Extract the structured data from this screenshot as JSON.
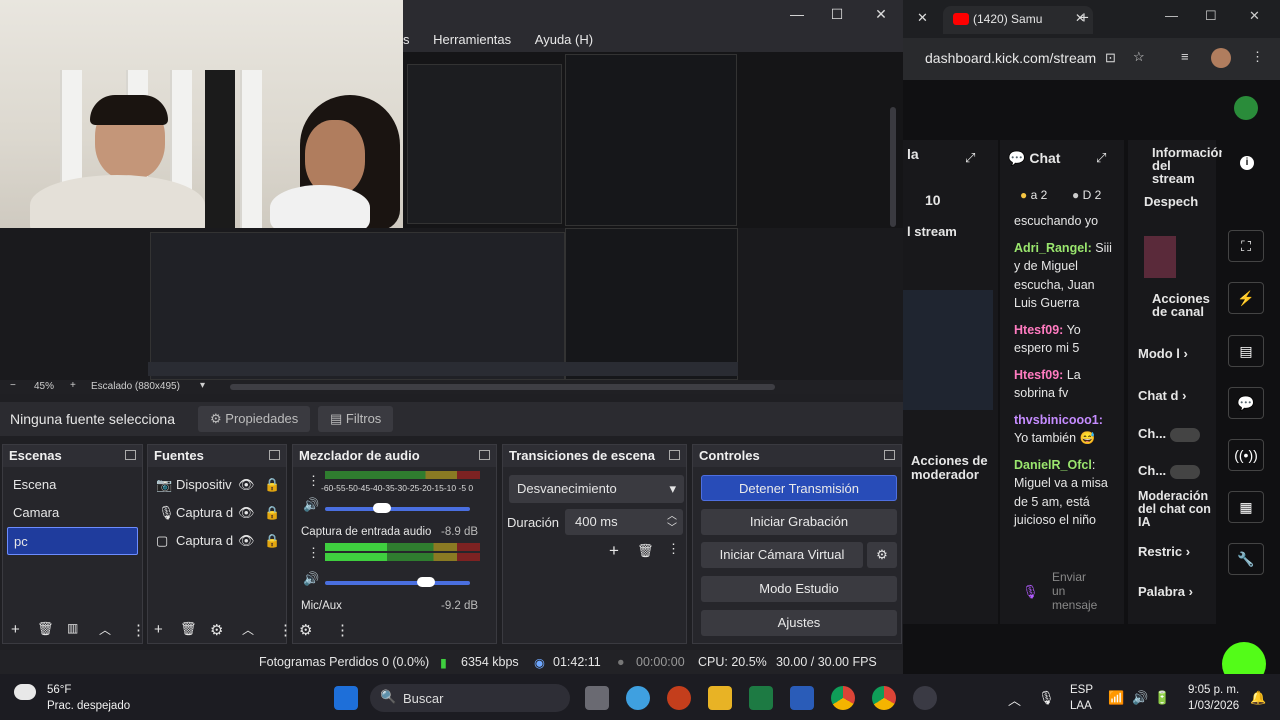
{
  "obs": {
    "menu": [
      "s",
      "Herramientas",
      "Ayuda (H)"
    ],
    "zoom_label": "45%",
    "scale_label": "Escalado (880x495)",
    "no_source_label": "Ninguna fuente selecciona",
    "properties_label": "Propiedades",
    "filters_label": "Filtros",
    "scenes": {
      "title": "Escenas",
      "items": [
        "Escena",
        "Camara",
        "pc"
      ],
      "selected": "pc"
    },
    "sources": {
      "title": "Fuentes",
      "items": [
        "Dispositiv",
        "Captura d",
        "Captura d"
      ]
    },
    "mixer": {
      "title": "Mezclador de audio",
      "scale": "-60-55-50-45-40-35-30-25-20-15-10 -5  0",
      "channel_1_name": "Captura de entrada audio",
      "channel_1_db": "-8.9 dB",
      "channel_2_name": "Mic/Aux",
      "channel_2_db": "-9.2 dB"
    },
    "transitions": {
      "title": "Transiciones de escena",
      "selected": "Desvanecimiento",
      "duration_label": "Duración",
      "duration_value": "400 ms"
    },
    "controls": {
      "title": "Controles",
      "stop_stream": "Detener Transmisión",
      "start_recording": "Iniciar Grabación",
      "virtual_cam": "Iniciar Cámara Virtual",
      "studio_mode": "Modo Estudio",
      "settings": "Ajustes"
    },
    "status": {
      "dropped_frames": "Fotogramas Perdidos 0 (0.0%)",
      "bitrate": "6354 kbps",
      "stream_time": "01:42:11",
      "record_time": "00:00:00",
      "cpu": "CPU: 20.5%",
      "fps": "30.00 / 30.00 FPS"
    }
  },
  "browser": {
    "tab_title": "(1420) Samu",
    "url": "dashboard.kick.com/stream",
    "left_cut_text": "la",
    "count_10": "10",
    "stream_label": "l stream",
    "mod_actions": "Acciones de moderador",
    "chat": {
      "title": "Chat",
      "badge_a": "a 2",
      "badge_d": "D 2",
      "messages": [
        {
          "user": "",
          "text": "escuchando yo"
        },
        {
          "user": "Adri_Rangel:",
          "text": "Siii y de Miguel escucha, Juan Luis Guerra"
        },
        {
          "user": "Htesf09:",
          "text": "Yo espero mi 5"
        },
        {
          "user": "Htesf09:",
          "text": "La sobrina fv"
        },
        {
          "user": "thvsbinicooo1:",
          "text": "Yo también 😅"
        },
        {
          "user": "DanielR_Ofcl",
          "text": ": Miguel va a misa de 5 am, está juicioso el niño"
        }
      ],
      "send_placeholder": "Enviar un mensaje"
    },
    "info": {
      "title": "Información del stream",
      "despech": "Despech",
      "actions_title": "Acciones de canal",
      "mode": "Modo l",
      "chat_d": "Chat d",
      "ch1": "Ch...",
      "ch2": "Ch...",
      "ai_mod": "Moderación del chat con IA",
      "restrict": "Restric",
      "words": "Palabra"
    }
  },
  "taskbar": {
    "weather_temp": "56°F",
    "weather_desc": "Prac. despejado",
    "search": "Buscar",
    "lang_1": "ESP",
    "lang_2": "LAA",
    "time": "9:05 p. m.",
    "date": "1/03/2026"
  },
  "colors": {
    "accent_blue": "#284cb8",
    "kick_green": "#53fc18",
    "dock_bg": "#26262b"
  }
}
